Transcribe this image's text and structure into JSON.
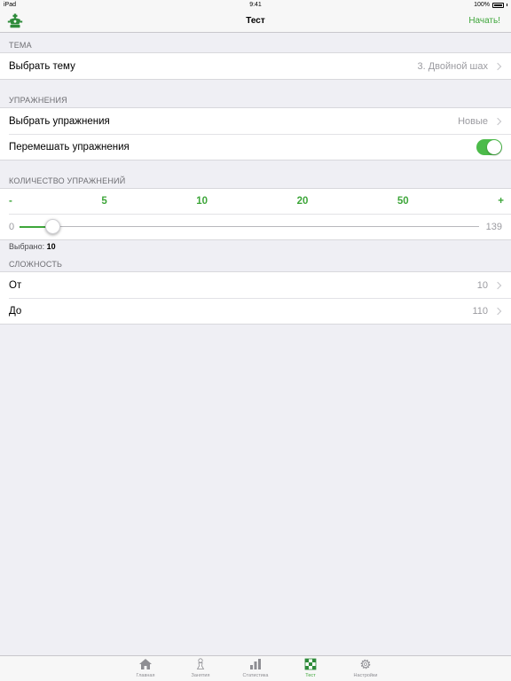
{
  "status_bar": {
    "carrier": "iPad",
    "time": "9:41",
    "battery": "100%"
  },
  "nav": {
    "title": "Тест",
    "start_label": "Начать!",
    "logo_icon": "chess-king-logo-icon"
  },
  "sections": {
    "theme": {
      "header": "ТЕМА",
      "rows": [
        {
          "label": "Выбрать тему",
          "value": "3. Двойной шах"
        }
      ]
    },
    "exercises": {
      "header": "УПРАЖНЕНИЯ",
      "choose_label": "Выбрать упражнения",
      "choose_value": "Новые",
      "shuffle_label": "Перемешать упражнения",
      "shuffle_on": true
    },
    "count": {
      "header": "КОЛИЧЕСТВО УПРАЖНЕНИЙ",
      "quick": [
        "-",
        "5",
        "10",
        "20",
        "50",
        "+"
      ],
      "min": "0",
      "max": "139",
      "value_fraction": 0.072,
      "selected_prefix": "Выбрано:",
      "selected_value": "10"
    },
    "difficulty": {
      "header": "СЛОЖНОСТЬ",
      "from_label": "От",
      "from_value": "10",
      "to_label": "До",
      "to_value": "110"
    }
  },
  "tabs": [
    {
      "label": "Главная",
      "icon": "home-icon",
      "active": false
    },
    {
      "label": "Занятия",
      "icon": "pawn-icon",
      "active": false
    },
    {
      "label": "Статистика",
      "icon": "bar-chart-icon",
      "active": false
    },
    {
      "label": "Тест",
      "icon": "checkerboard-icon",
      "active": true
    },
    {
      "label": "Настройки",
      "icon": "gear-icon",
      "active": false
    }
  ],
  "colors": {
    "accent": "#3ea63a",
    "toggle_on": "#4cbb4a",
    "background": "#efeff4"
  }
}
